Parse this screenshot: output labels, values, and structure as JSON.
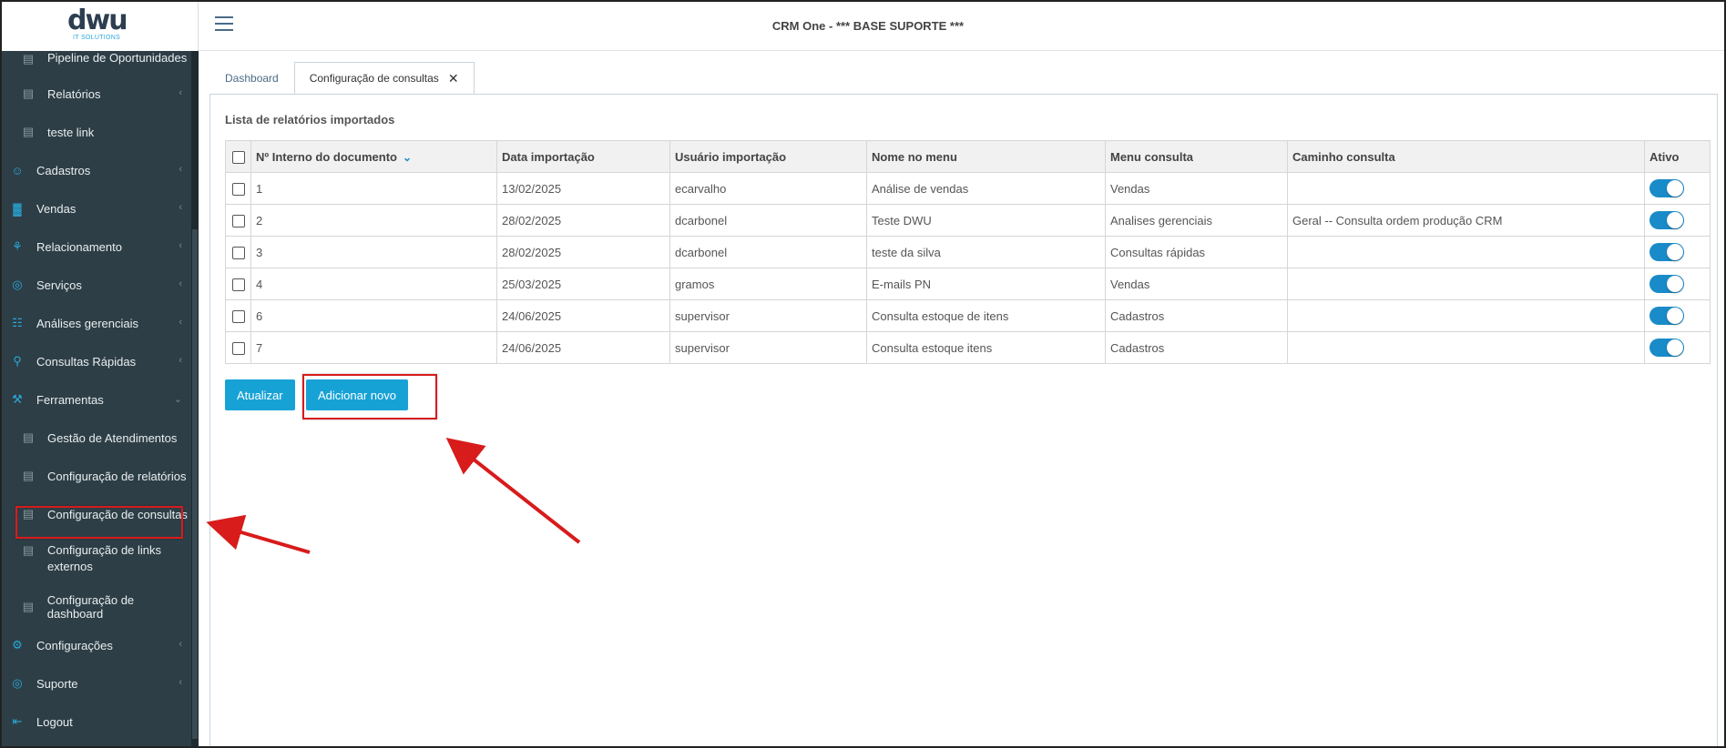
{
  "logo": {
    "mark": "dwu",
    "sub": "IT SOLUTIONS"
  },
  "header": {
    "title": "CRM One - *** BASE SUPORTE ***"
  },
  "sidebar": {
    "items": [
      {
        "label": "Pipeline de Oportunidades",
        "icon": "book-icon",
        "sub": true,
        "chevron": false
      },
      {
        "label": "Relatórios",
        "icon": "book-icon",
        "sub": true,
        "chevron": true
      },
      {
        "label": "teste link",
        "icon": "book-icon",
        "sub": true,
        "chevron": false
      },
      {
        "label": "Cadastros",
        "icon": "user-icon",
        "sub": false,
        "chevron": true
      },
      {
        "label": "Vendas",
        "icon": "bar-chart-icon",
        "sub": false,
        "chevron": true
      },
      {
        "label": "Relacionamento",
        "icon": "handshake-icon",
        "sub": false,
        "chevron": true
      },
      {
        "label": "Serviços",
        "icon": "lifebuoy-icon",
        "sub": false,
        "chevron": true
      },
      {
        "label": "Análises gerenciais",
        "icon": "report-icon",
        "sub": false,
        "chevron": true
      },
      {
        "label": "Consultas Rápidas",
        "icon": "search-icon",
        "sub": false,
        "chevron": true
      },
      {
        "label": "Ferramentas",
        "icon": "wrench-icon",
        "sub": false,
        "chevron": true,
        "expanded": true
      },
      {
        "label": "Gestão de Atendimentos",
        "icon": "book-icon",
        "sub": true,
        "chevron": false
      },
      {
        "label": "Configuração de relatórios",
        "icon": "book-icon",
        "sub": true,
        "chevron": false
      },
      {
        "label": "Configuração de consultas",
        "icon": "book-icon",
        "sub": true,
        "chevron": false,
        "active": true
      },
      {
        "label": "Configuração de links externos",
        "icon": "book-icon",
        "sub": true,
        "chevron": false
      },
      {
        "label": "Configuração de dashboard",
        "icon": "book-icon",
        "sub": true,
        "chevron": false
      },
      {
        "label": "Configurações",
        "icon": "gear-icon",
        "sub": false,
        "chevron": true
      },
      {
        "label": "Suporte",
        "icon": "lifebuoy-icon",
        "sub": false,
        "chevron": true
      },
      {
        "label": "Logout",
        "icon": "logout-icon",
        "sub": false,
        "chevron": false
      }
    ]
  },
  "tabs": [
    {
      "label": "Dashboard",
      "active": false
    },
    {
      "label": "Configuração de consultas",
      "active": true,
      "close": "✕"
    }
  ],
  "main": {
    "title": "Lista de relatórios importados",
    "columns": [
      "Nº Interno do documento",
      "Data importação",
      "Usuário importação",
      "Nome no menu",
      "Menu consulta",
      "Caminho consulta",
      "Ativo"
    ],
    "rows": [
      {
        "id": "1",
        "date": "13/02/2025",
        "user": "ecarvalho",
        "name": "Análise de vendas",
        "menu": "Vendas",
        "path": "",
        "active": true
      },
      {
        "id": "2",
        "date": "28/02/2025",
        "user": "dcarbonel",
        "name": "Teste DWU",
        "menu": "Analises gerenciais",
        "path": "Geral -- Consulta ordem produção CRM",
        "active": true
      },
      {
        "id": "3",
        "date": "28/02/2025",
        "user": "dcarbonel",
        "name": "teste da silva",
        "menu": "Consultas rápidas",
        "path": "",
        "active": true
      },
      {
        "id": "4",
        "date": "25/03/2025",
        "user": "gramos",
        "name": "E-mails PN",
        "menu": "Vendas",
        "path": "",
        "active": true
      },
      {
        "id": "6",
        "date": "24/06/2025",
        "user": "supervisor",
        "name": "Consulta estoque de itens",
        "menu": "Cadastros",
        "path": "",
        "active": true
      },
      {
        "id": "7",
        "date": "24/06/2025",
        "user": "supervisor",
        "name": "Consulta estoque itens",
        "menu": "Cadastros",
        "path": "",
        "active": true
      }
    ],
    "buttons": {
      "refresh": "Atualizar",
      "add": "Adicionar novo"
    }
  },
  "colors": {
    "sidebar": "#2e3e46",
    "accent": "#17a2d6",
    "annotation": "#d81b1b"
  }
}
